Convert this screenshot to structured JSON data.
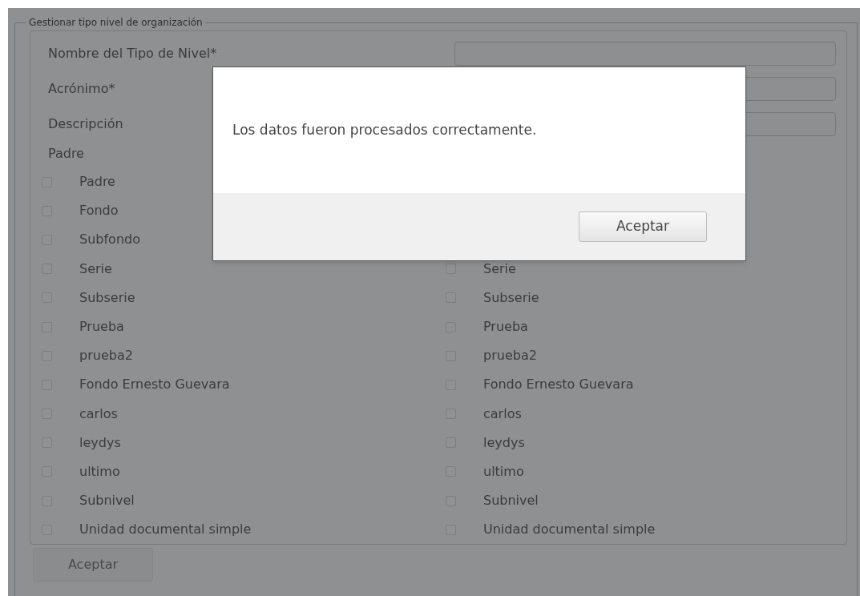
{
  "fieldset": {
    "legend": "Gestionar tipo nivel de organización",
    "fields": [
      {
        "label": "Nombre del Tipo de Nivel*"
      },
      {
        "label": "Acrónimo*"
      },
      {
        "label": "Descripción"
      }
    ],
    "parent_label": "Padre",
    "left_options": [
      {
        "label": "Padre",
        "checked": false
      },
      {
        "label": "Fondo",
        "checked": false
      },
      {
        "label": "Subfondo",
        "checked": false
      },
      {
        "label": "Serie",
        "checked": false
      },
      {
        "label": "Subserie",
        "checked": false
      },
      {
        "label": "Prueba",
        "checked": false
      },
      {
        "label": "prueba2",
        "checked": false
      },
      {
        "label": "Fondo Ernesto Guevara",
        "checked": false
      },
      {
        "label": "carlos",
        "checked": false
      },
      {
        "label": "leydys",
        "checked": false
      },
      {
        "label": "ultimo",
        "checked": false
      },
      {
        "label": "Subnivel",
        "checked": false
      },
      {
        "label": "Unidad documental simple",
        "checked": false
      }
    ],
    "right_options": [
      {
        "label": "Serie",
        "checked": false
      },
      {
        "label": "Subserie",
        "checked": false
      },
      {
        "label": "Prueba",
        "checked": false
      },
      {
        "label": "prueba2",
        "checked": false
      },
      {
        "label": "Fondo Ernesto Guevara",
        "checked": false
      },
      {
        "label": "carlos",
        "checked": false
      },
      {
        "label": "leydys",
        "checked": false
      },
      {
        "label": "ultimo",
        "checked": false
      },
      {
        "label": "Subnivel",
        "checked": false
      },
      {
        "label": "Unidad documental simple",
        "checked": false
      }
    ],
    "submit": "Aceptar"
  },
  "dialog": {
    "message": "Los datos fueron procesados correctamente.",
    "button": "Aceptar"
  }
}
